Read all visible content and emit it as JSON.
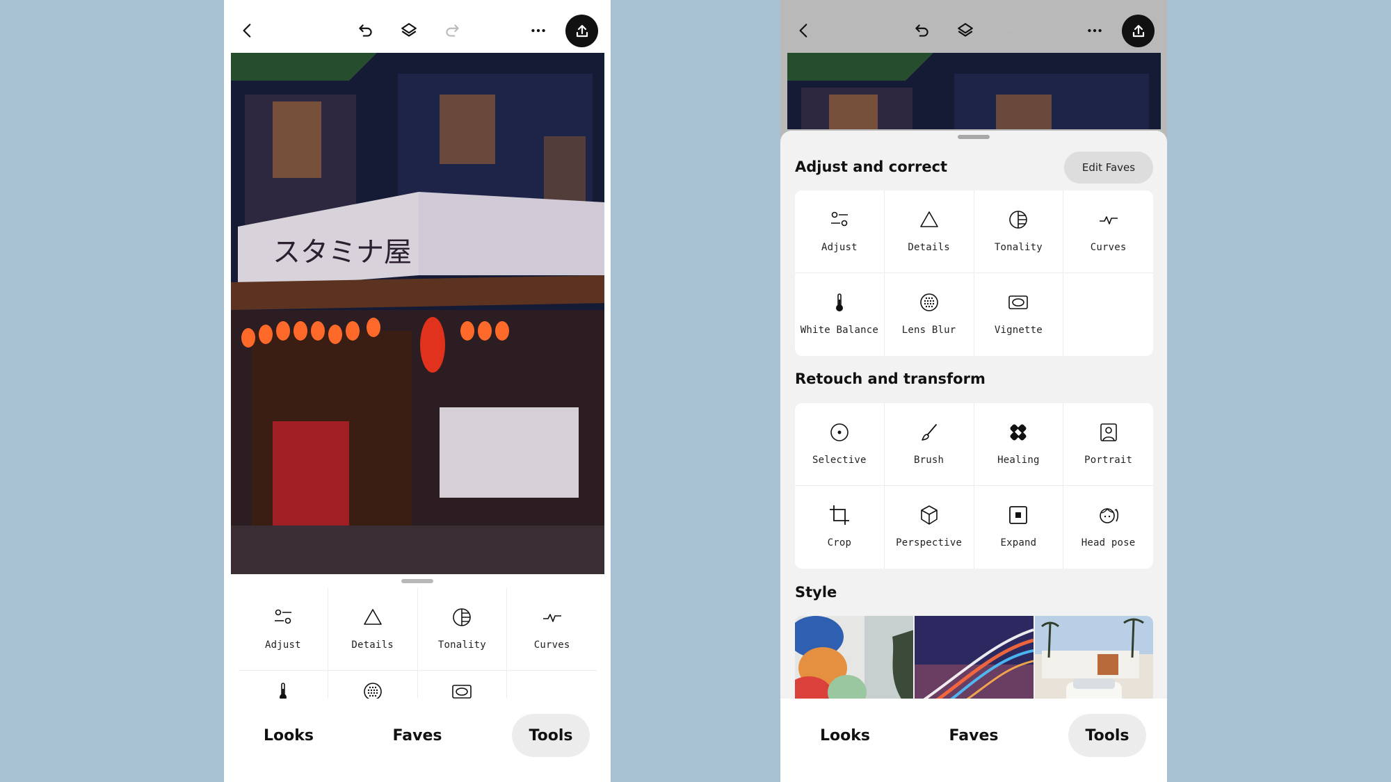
{
  "colors": {
    "background": "#a9c2d3",
    "accent": "#111111"
  },
  "left": {
    "tools": [
      {
        "label": "Adjust",
        "icon": "adjust-icon"
      },
      {
        "label": "Details",
        "icon": "triangle-icon"
      },
      {
        "label": "Tonality",
        "icon": "tonality-icon"
      },
      {
        "label": "Curves",
        "icon": "curves-icon"
      }
    ]
  },
  "nav": {
    "looks": "Looks",
    "faves": "Faves",
    "tools": "Tools"
  },
  "right": {
    "section1": "Adjust and correct",
    "edit_faves": "Edit Faves",
    "tools1": [
      {
        "label": "Adjust",
        "icon": "adjust-icon"
      },
      {
        "label": "Details",
        "icon": "triangle-icon"
      },
      {
        "label": "Tonality",
        "icon": "tonality-icon"
      },
      {
        "label": "Curves",
        "icon": "curves-icon"
      },
      {
        "label": "White Balance",
        "icon": "thermometer-icon"
      },
      {
        "label": "Lens Blur",
        "icon": "lens-blur-icon"
      },
      {
        "label": "Vignette",
        "icon": "vignette-icon"
      }
    ],
    "section2": "Retouch and transform",
    "tools2": [
      {
        "label": "Selective",
        "icon": "selective-icon"
      },
      {
        "label": "Brush",
        "icon": "brush-icon"
      },
      {
        "label": "Healing",
        "icon": "healing-icon"
      },
      {
        "label": "Portrait",
        "icon": "portrait-icon"
      },
      {
        "label": "Crop",
        "icon": "crop-icon"
      },
      {
        "label": "Perspective",
        "icon": "perspective-icon"
      },
      {
        "label": "Expand",
        "icon": "expand-icon"
      },
      {
        "label": "Head pose",
        "icon": "head-pose-icon"
      }
    ],
    "section3": "Style"
  }
}
